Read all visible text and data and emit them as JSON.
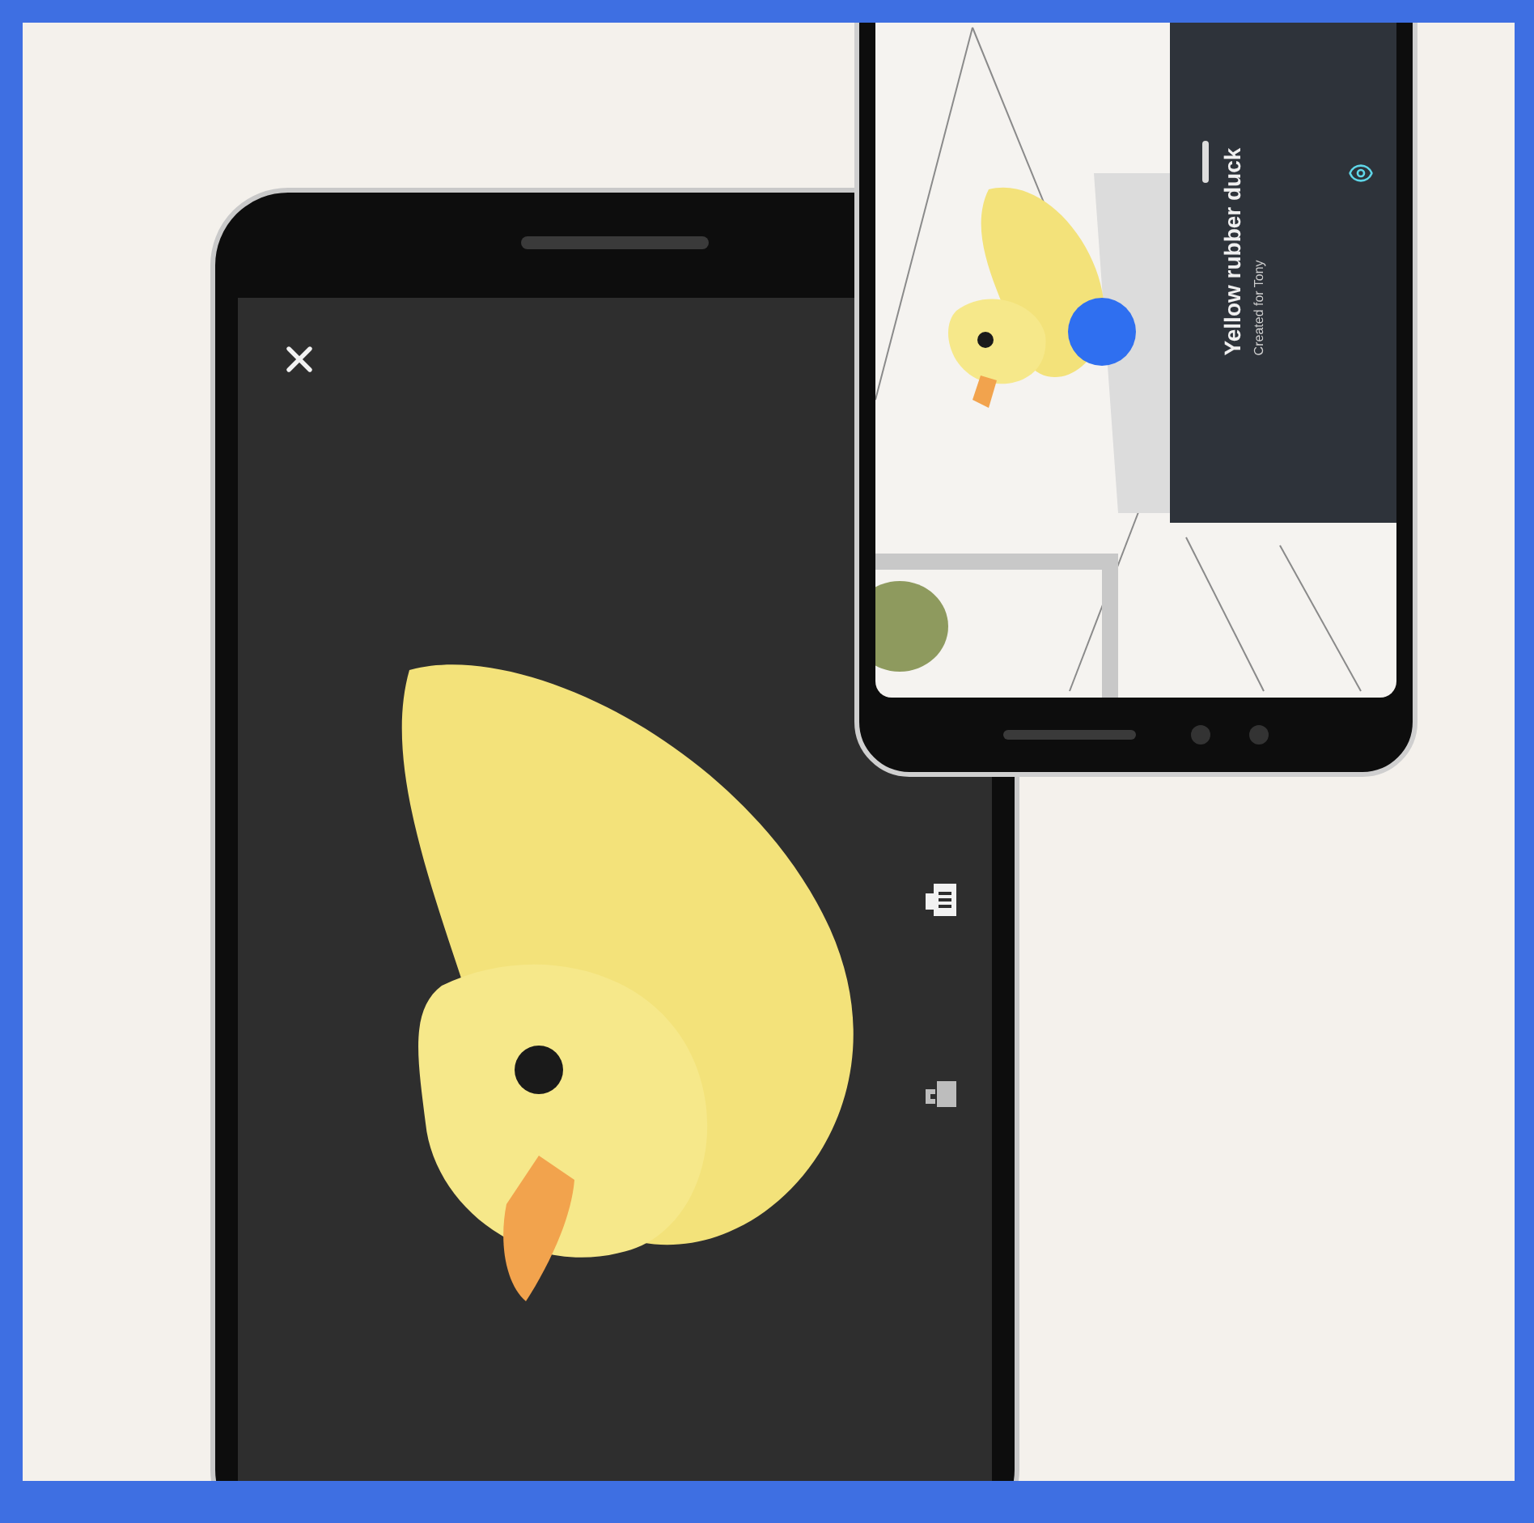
{
  "ar_card": {
    "title": "Yellow rubber duck",
    "subtitle": "Created for Tony"
  }
}
